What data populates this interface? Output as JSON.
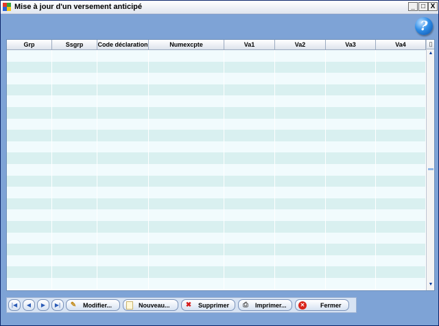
{
  "window": {
    "title": "Mise à jour d'un versement anticipé",
    "min_glyph": "_",
    "max_glyph": "□",
    "close_glyph": "X"
  },
  "help": {
    "glyph": "?",
    "icon": "help-icon",
    "color": "#2f8ee8"
  },
  "grid": {
    "columns": [
      "Grp",
      "Ssgrp",
      "Code déclaration",
      "Numexcpte",
      "Va1",
      "Va2",
      "Va3",
      "Va4"
    ],
    "row_colors": [
      "#f1fbfd",
      "#d9f0f0"
    ],
    "corner_glyph": "▯",
    "scroll_up_glyph": "▲",
    "scroll_down_glyph": "▼"
  },
  "toolbar": {
    "nav": [
      {
        "glyph": "|◀",
        "icon": "first-record-icon"
      },
      {
        "glyph": "◀",
        "icon": "previous-record-icon"
      },
      {
        "glyph": "▶",
        "icon": "next-record-icon"
      },
      {
        "glyph": "▶|",
        "icon": "last-record-icon"
      }
    ],
    "buttons": [
      {
        "label": "Modifier...",
        "icon": "pencil-icon",
        "glyph": "✎"
      },
      {
        "label": "Nouveau...",
        "icon": "new-document-icon",
        "glyph": ""
      },
      {
        "label": "Supprimer",
        "icon": "delete-icon",
        "glyph": "✖"
      },
      {
        "label": "Imprimer...",
        "icon": "printer-icon",
        "glyph": "⎙"
      },
      {
        "label": "Fermer",
        "icon": "close-circle-icon",
        "glyph": "✕"
      }
    ]
  }
}
